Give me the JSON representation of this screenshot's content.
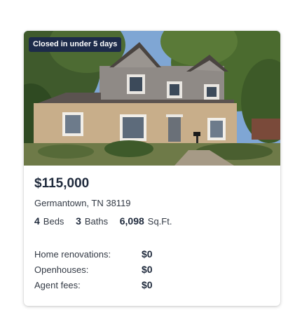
{
  "listing": {
    "badge": "Closed in under 5 days",
    "photo_alt": "Two-story brick house with gray siding",
    "price": "$115,000",
    "address": "Germantown, TN 38119",
    "beds": {
      "value": "4",
      "unit": "Beds"
    },
    "baths": {
      "value": "3",
      "unit": "Baths"
    },
    "area": {
      "value": "6,098",
      "unit": "Sq.Ft."
    },
    "fees": [
      {
        "label": "Home renovations:",
        "value": "$0"
      },
      {
        "label": "Openhouses:",
        "value": "$0"
      },
      {
        "label": "Agent fees:",
        "value": "$0"
      }
    ]
  },
  "colors": {
    "badge_bg": "#1d2b4a",
    "text_dark": "#1f2a3c",
    "text_body": "#333a45"
  }
}
